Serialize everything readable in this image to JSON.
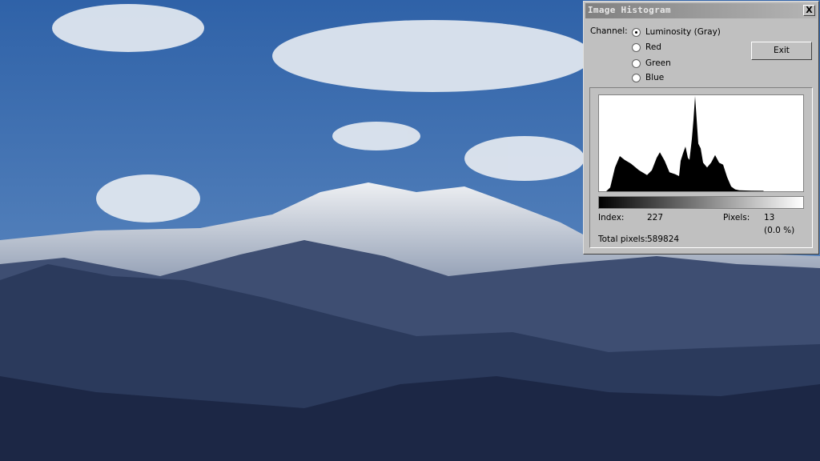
{
  "dialog": {
    "title": "Image Histogram",
    "close_label": "X",
    "channel_label": "Channel:",
    "channels": [
      {
        "label": "Luminosity (Gray)",
        "selected": true
      },
      {
        "label": "Red",
        "selected": false
      },
      {
        "label": "Green",
        "selected": false
      },
      {
        "label": "Blue",
        "selected": false
      }
    ],
    "exit_label": "Exit",
    "index_label": "Index:",
    "index_value": "227",
    "pixels_label": "Pixels:",
    "pixels_value": "13",
    "pixels_percent": "(0.0 %)",
    "total_label": "Total pixels:",
    "total_value": "589824"
  },
  "chart_data": {
    "type": "area",
    "title": "Luminosity histogram",
    "xlim": [
      0,
      255
    ],
    "ylim": [
      0,
      1
    ],
    "x": [
      0,
      9,
      14,
      20,
      26,
      32,
      40,
      50,
      60,
      66,
      72,
      76,
      82,
      88,
      95,
      100,
      102,
      105,
      108,
      111,
      113,
      116,
      118,
      120,
      122,
      124,
      127,
      130,
      135,
      140,
      145,
      150,
      155,
      160,
      165,
      170,
      175,
      190,
      205,
      206,
      255
    ],
    "y": [
      0,
      0,
      0.04,
      0.25,
      0.37,
      0.33,
      0.29,
      0.22,
      0.17,
      0.22,
      0.35,
      0.41,
      0.32,
      0.2,
      0.18,
      0.16,
      0.32,
      0.4,
      0.47,
      0.35,
      0.33,
      0.55,
      0.75,
      1.0,
      0.75,
      0.5,
      0.45,
      0.3,
      0.25,
      0.3,
      0.38,
      0.3,
      0.28,
      0.15,
      0.05,
      0.02,
      0.01,
      0.006,
      0.005,
      0,
      0
    ]
  }
}
